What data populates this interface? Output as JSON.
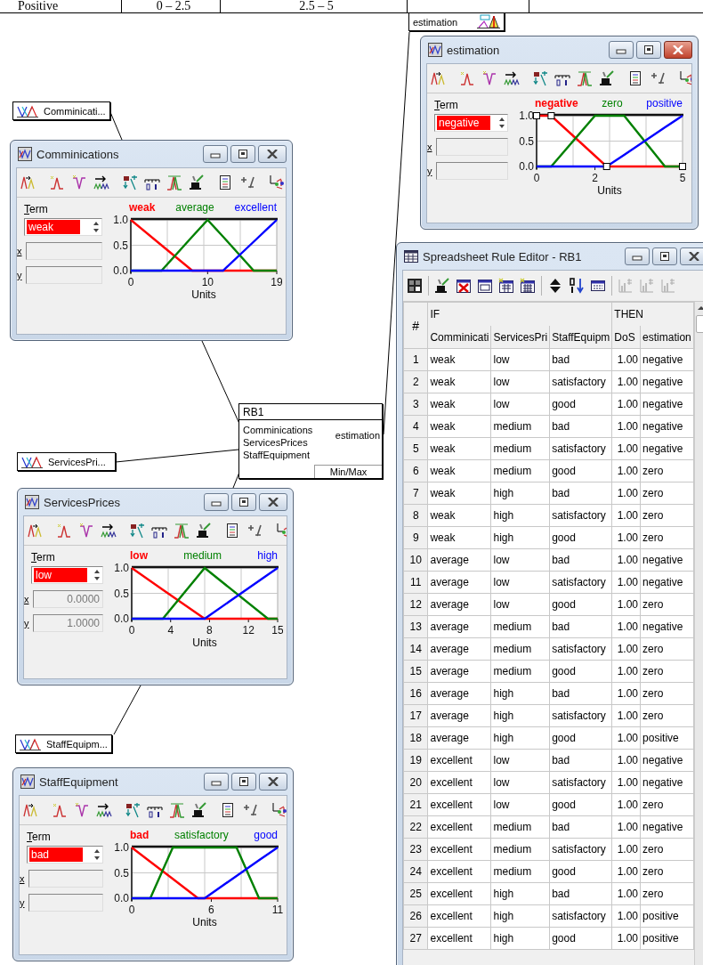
{
  "background_table": {
    "cells": [
      "Positive",
      "0 – 2.5",
      "2.5 – 5"
    ]
  },
  "variable_nodes": [
    {
      "kind": "input",
      "label": "Comminicati..."
    },
    {
      "kind": "input",
      "label": "ServicesPri..."
    },
    {
      "kind": "input",
      "label": "StaffEquipm..."
    },
    {
      "kind": "output",
      "label": "estimation"
    }
  ],
  "variable_windows": [
    {
      "title": "estimation",
      "active": true,
      "term_label": "Term",
      "term_value": "negative",
      "x_label": "x",
      "y_label": "y",
      "terms": [
        {
          "label": "negative",
          "selected": true
        },
        {
          "label": "zero",
          "selected": false
        },
        {
          "label": "positive",
          "selected": false
        }
      ],
      "chart_data": {
        "type": "line",
        "xlabel": "Units",
        "x": [
          0,
          0.5,
          2,
          2.4,
          3,
          4.4,
          5
        ],
        "xlim": [
          0,
          5
        ],
        "ylim": [
          0,
          1
        ],
        "xticks": [
          0,
          2,
          5
        ],
        "yticks": [
          {
            "value": 1,
            "label": "1.0"
          },
          {
            "value": 0.5,
            "label": "0.5"
          },
          {
            "value": 0,
            "label": "0.0"
          }
        ],
        "series": [
          {
            "color": "#ff0000",
            "values": [
              1,
              1,
              0.21,
              0,
              0,
              0,
              0
            ]
          },
          {
            "color": "#008000",
            "values": [
              0,
              0,
              1,
              1,
              1,
              0,
              0
            ]
          },
          {
            "color": "#0000ff",
            "values": [
              0,
              0,
              0,
              0,
              0.23,
              0.77,
              1
            ]
          }
        ]
      }
    },
    {
      "title": "Comminications",
      "active": false,
      "term_label": "Term",
      "term_value": "weak",
      "x_label": "x",
      "y_label": "y",
      "terms": [
        {
          "label": "weak",
          "selected": true
        },
        {
          "label": "average",
          "selected": false
        },
        {
          "label": "excellent",
          "selected": false
        }
      ],
      "chart_data": {
        "type": "line",
        "xlabel": "Units",
        "x": [
          0,
          4,
          8,
          10,
          12,
          16,
          19
        ],
        "xlim": [
          0,
          19
        ],
        "ylim": [
          0,
          1
        ],
        "xticks": [
          0,
          10,
          19
        ],
        "yticks": [
          {
            "value": 1,
            "label": "1.0"
          },
          {
            "value": 0.5,
            "label": "0.5"
          },
          {
            "value": 0,
            "label": "0.0"
          }
        ],
        "series": [
          {
            "color": "#ff0000",
            "values": [
              1,
              0.5,
              0,
              0,
              0,
              0,
              0
            ]
          },
          {
            "color": "#008000",
            "values": [
              0,
              0,
              0.67,
              1,
              0.67,
              0,
              0
            ]
          },
          {
            "color": "#0000ff",
            "values": [
              0,
              0,
              0,
              0,
              0,
              0.57,
              1
            ]
          }
        ]
      }
    },
    {
      "title": "ServicesPrices",
      "active": false,
      "term_label": "Term",
      "term_value": "low",
      "x_label": "x",
      "x_value": "0.0000",
      "y_label": "y",
      "y_value": "1.0000",
      "terms": [
        {
          "label": "low",
          "selected": true
        },
        {
          "label": "medium",
          "selected": false
        },
        {
          "label": "high",
          "selected": false
        }
      ],
      "chart_data": {
        "type": "line",
        "xlabel": "Units",
        "x": [
          0,
          3.2,
          7.5,
          14,
          15
        ],
        "xlim": [
          0,
          15
        ],
        "ylim": [
          0,
          1
        ],
        "xticks": [
          0,
          4,
          8,
          12,
          15
        ],
        "yticks": [
          {
            "value": 1,
            "label": "1.0"
          },
          {
            "value": 0.5,
            "label": "0.5"
          },
          {
            "value": 0,
            "label": "0.0"
          }
        ],
        "series": [
          {
            "color": "#ff0000",
            "values": [
              1,
              0.57,
              0,
              0,
              0
            ]
          },
          {
            "color": "#008000",
            "values": [
              0,
              0,
              1,
              0,
              0
            ]
          },
          {
            "color": "#0000ff",
            "values": [
              0,
              0,
              0,
              0.87,
              1
            ]
          }
        ]
      }
    },
    {
      "title": "StaffEquipment",
      "active": false,
      "term_label": "Term",
      "term_value": "bad",
      "x_label": "x",
      "y_label": "y",
      "terms": [
        {
          "label": "bad",
          "selected": true
        },
        {
          "label": "satisfactory",
          "selected": false
        },
        {
          "label": "good",
          "selected": false
        }
      ],
      "chart_data": {
        "type": "line",
        "xlabel": "Units",
        "x": [
          0,
          1.4,
          3.1,
          5,
          5.5,
          7.9,
          9.6,
          11
        ],
        "xlim": [
          0,
          11
        ],
        "ylim": [
          0,
          1
        ],
        "xticks": [
          0,
          6,
          11
        ],
        "yticks": [
          {
            "value": 1,
            "label": "1.0"
          },
          {
            "value": 0.5,
            "label": "0.5"
          },
          {
            "value": 0,
            "label": "0.0"
          }
        ],
        "series": [
          {
            "color": "#ff0000",
            "values": [
              1,
              0.72,
              0.38,
              0,
              0,
              0,
              0,
              0
            ]
          },
          {
            "color": "#008000",
            "values": [
              0,
              0,
              1,
              1,
              1,
              1,
              0,
              0
            ]
          },
          {
            "color": "#0000ff",
            "values": [
              0,
              0,
              0,
              0,
              0,
              0.44,
              0.75,
              1
            ]
          }
        ]
      }
    }
  ],
  "rule_block": {
    "title": "RB1",
    "inputs": [
      "Comminications",
      "ServicesPrices",
      "StaffEquipment"
    ],
    "output": "estimation",
    "method": "Min/Max"
  },
  "spreadsheet": {
    "title": "Spreadsheet Rule Editor - RB1",
    "if_label": "IF",
    "then_label": "THEN",
    "columns": [
      "#",
      "Comminicati",
      "ServicesPri",
      "StaffEquipm",
      "DoS",
      "estimation"
    ],
    "rows": [
      [
        "1",
        "weak",
        "low",
        "bad",
        "1.00",
        "negative"
      ],
      [
        "2",
        "weak",
        "low",
        "satisfactory",
        "1.00",
        "negative"
      ],
      [
        "3",
        "weak",
        "low",
        "good",
        "1.00",
        "negative"
      ],
      [
        "4",
        "weak",
        "medium",
        "bad",
        "1.00",
        "negative"
      ],
      [
        "5",
        "weak",
        "medium",
        "satisfactory",
        "1.00",
        "negative"
      ],
      [
        "6",
        "weak",
        "medium",
        "good",
        "1.00",
        "zero"
      ],
      [
        "7",
        "weak",
        "high",
        "bad",
        "1.00",
        "zero"
      ],
      [
        "8",
        "weak",
        "high",
        "satisfactory",
        "1.00",
        "zero"
      ],
      [
        "9",
        "weak",
        "high",
        "good",
        "1.00",
        "zero"
      ],
      [
        "10",
        "average",
        "low",
        "bad",
        "1.00",
        "negative"
      ],
      [
        "11",
        "average",
        "low",
        "satisfactory",
        "1.00",
        "negative"
      ],
      [
        "12",
        "average",
        "low",
        "good",
        "1.00",
        "zero"
      ],
      [
        "13",
        "average",
        "medium",
        "bad",
        "1.00",
        "negative"
      ],
      [
        "14",
        "average",
        "medium",
        "satisfactory",
        "1.00",
        "zero"
      ],
      [
        "15",
        "average",
        "medium",
        "good",
        "1.00",
        "zero"
      ],
      [
        "16",
        "average",
        "high",
        "bad",
        "1.00",
        "zero"
      ],
      [
        "17",
        "average",
        "high",
        "satisfactory",
        "1.00",
        "zero"
      ],
      [
        "18",
        "average",
        "high",
        "good",
        "1.00",
        "positive"
      ],
      [
        "19",
        "excellent",
        "low",
        "bad",
        "1.00",
        "negative"
      ],
      [
        "20",
        "excellent",
        "low",
        "satisfactory",
        "1.00",
        "negative"
      ],
      [
        "21",
        "excellent",
        "low",
        "good",
        "1.00",
        "zero"
      ],
      [
        "22",
        "excellent",
        "medium",
        "bad",
        "1.00",
        "negative"
      ],
      [
        "23",
        "excellent",
        "medium",
        "satisfactory",
        "1.00",
        "zero"
      ],
      [
        "24",
        "excellent",
        "medium",
        "good",
        "1.00",
        "zero"
      ],
      [
        "25",
        "excellent",
        "high",
        "bad",
        "1.00",
        "zero"
      ],
      [
        "26",
        "excellent",
        "high",
        "satisfactory",
        "1.00",
        "positive"
      ],
      [
        "27",
        "excellent",
        "high",
        "good",
        "1.00",
        "positive"
      ]
    ]
  }
}
